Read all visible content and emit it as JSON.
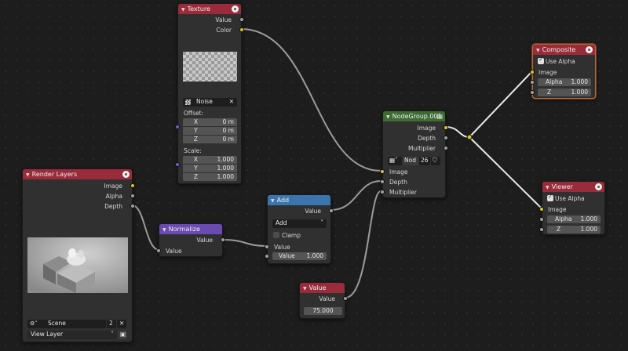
{
  "texture": {
    "title": "Texture",
    "out_value": "Value",
    "out_color": "Color",
    "image_name": "Noise",
    "close": "✕",
    "offset_label": "Offset:",
    "offset": [
      {
        "axis": "X",
        "val": "0 m"
      },
      {
        "axis": "Y",
        "val": "0 m"
      },
      {
        "axis": "Z",
        "val": "0 m"
      }
    ],
    "scale_label": "Scale:",
    "scale": [
      {
        "axis": "X",
        "val": "1.000"
      },
      {
        "axis": "Y",
        "val": "1.000"
      },
      {
        "axis": "Z",
        "val": "1.000"
      }
    ]
  },
  "render_layers": {
    "title": "Render Layers",
    "outputs": [
      "Image",
      "Alpha",
      "Depth"
    ],
    "scene_name": "Scene",
    "scene_users": "2",
    "view_layer": "View Layer"
  },
  "normalize": {
    "title": "Normalize",
    "out_value": "Value",
    "in_value": "Value"
  },
  "add": {
    "title": "Add",
    "out_value": "Value",
    "operation": "Add",
    "clamp": "Clamp",
    "in_value1": "Value",
    "in_value2_label": "Value",
    "in_value2": "1.000"
  },
  "value_node": {
    "title": "Value",
    "out_value": "Value",
    "value": "75.000"
  },
  "nodegroup": {
    "title": "NodeGroup.001",
    "outputs": [
      "Image",
      "Depth",
      "Multiplier"
    ],
    "group_name": "Nod",
    "users": "26",
    "inputs": [
      "Image",
      "Depth",
      "Multiplier"
    ]
  },
  "composite": {
    "title": "Composite",
    "use_alpha": "Use Alpha",
    "image": "Image",
    "alpha_label": "Alpha",
    "alpha": "1.000",
    "z_label": "Z",
    "z": "1.000"
  },
  "viewer": {
    "title": "Viewer",
    "use_alpha": "Use Alpha",
    "image": "Image",
    "alpha_label": "Alpha",
    "alpha": "1.000",
    "z_label": "Z",
    "z": "1.000"
  },
  "colors": {
    "input_header": "#9a2b3a",
    "converter_header": "#6a4bb0",
    "math_header": "#3a76ad",
    "group_header": "#3d6b33",
    "socket_color": "#d4c52f",
    "socket_float": "#a0a0a0",
    "socket_vector": "#6363c7"
  }
}
